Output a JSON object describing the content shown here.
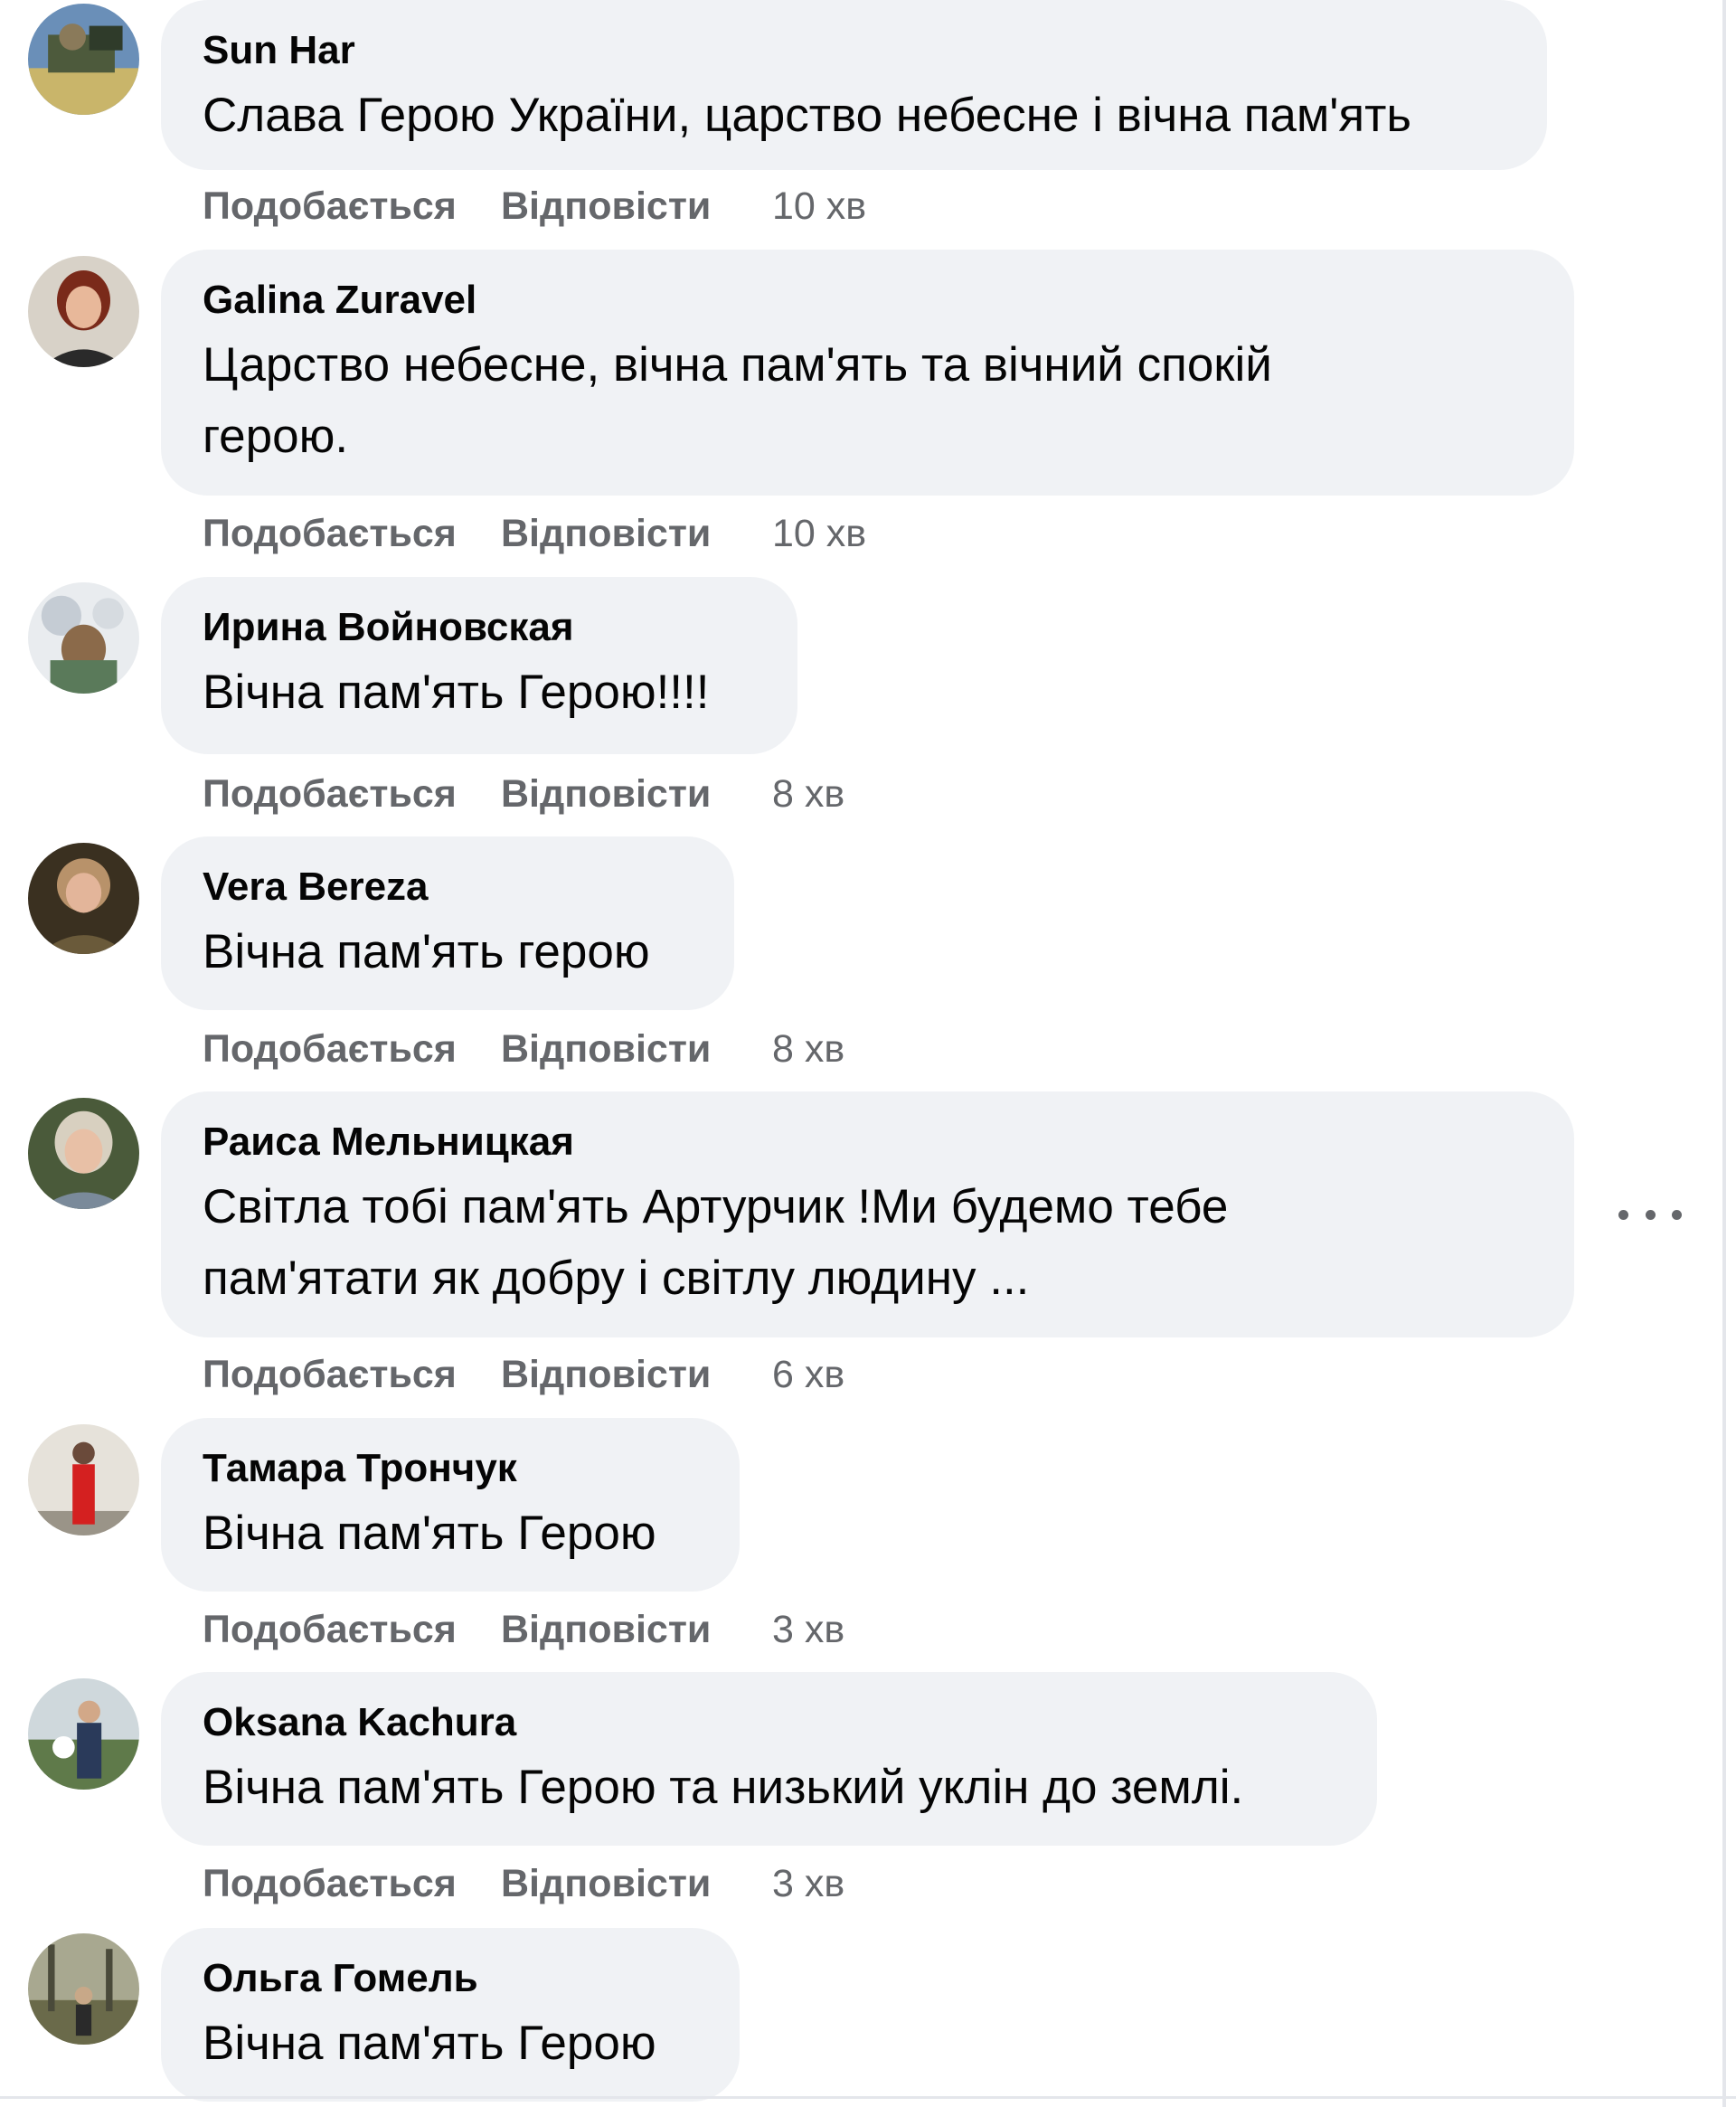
{
  "comments": [
    {
      "author": "Sun Har",
      "text": "Слава Герою України, царство небесне і вічна пам'ять",
      "like_label": "Подобається",
      "reply_label": "Відповісти",
      "time": "10 хв"
    },
    {
      "author": "Galina Zuravel",
      "text": "Царство небесне, вічна пам'ять та вічний спокій герою.",
      "like_label": "Подобається",
      "reply_label": "Відповісти",
      "time": "10 хв"
    },
    {
      "author": "Ирина Войновская",
      "text": "Вічна пам'ять Герою!!!!",
      "like_label": "Подобається",
      "reply_label": "Відповісти",
      "time": "8 хв"
    },
    {
      "author": "Vera Bereza",
      "text": "Вічна пам'ять герою",
      "like_label": "Подобається",
      "reply_label": "Відповісти",
      "time": "8 хв"
    },
    {
      "author": "Раиса Мельницкая",
      "text": "Світла тобі пам'ять Артурчик !Ми будемо тебе пам'ятати як добру і світлу людину ...",
      "like_label": "Подобається",
      "reply_label": "Відповісти",
      "time": "6 хв"
    },
    {
      "author": "Тамара Трончук",
      "text": "Вічна пам'ять Герою",
      "like_label": "Подобається",
      "reply_label": "Відповісти",
      "time": "3 хв"
    },
    {
      "author": "Oksana Kachura",
      "text": "Вічна пам'ять Герою та низький уклін до землі.",
      "like_label": "Подобається",
      "reply_label": "Відповісти",
      "time": "3 хв"
    },
    {
      "author": "Ольга Гомель",
      "text": "Вічна пам'ять Герою"
    }
  ],
  "more_options_icon": "more-horizontal-icon",
  "colors": {
    "bubble_bg": "#f0f2f5",
    "text": "#050505",
    "secondary_text": "#65676b",
    "border": "#e4e6eb"
  }
}
